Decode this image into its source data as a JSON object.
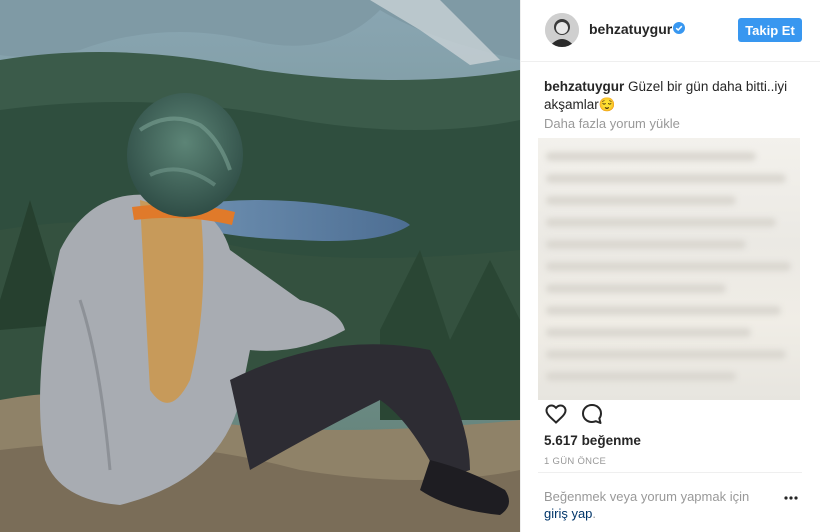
{
  "post": {
    "username": "behzatuygur",
    "follow_label": "Takip Et",
    "caption_username": "behzatuygur",
    "caption_text": "Güzel bir gün daha bitti..iyi akşamlar",
    "caption_emoji": "😌",
    "load_more_label": "Daha fazla yorum yükle",
    "likes_count": "5.617",
    "likes_suffix": "beğenme",
    "timestamp": "1 GÜN ÖNCE",
    "login_prompt": "Beğenmek veya yorum yapmak için",
    "login_link": "giriş yap",
    "login_suffix": "."
  },
  "icons": {
    "verified": "verified-badge-icon",
    "like": "heart-icon",
    "comment": "comment-bubble-icon",
    "more": "more-options-icon"
  },
  "colors": {
    "accent": "#3897f0",
    "link": "#003569",
    "muted": "#999999",
    "text": "#262626"
  }
}
